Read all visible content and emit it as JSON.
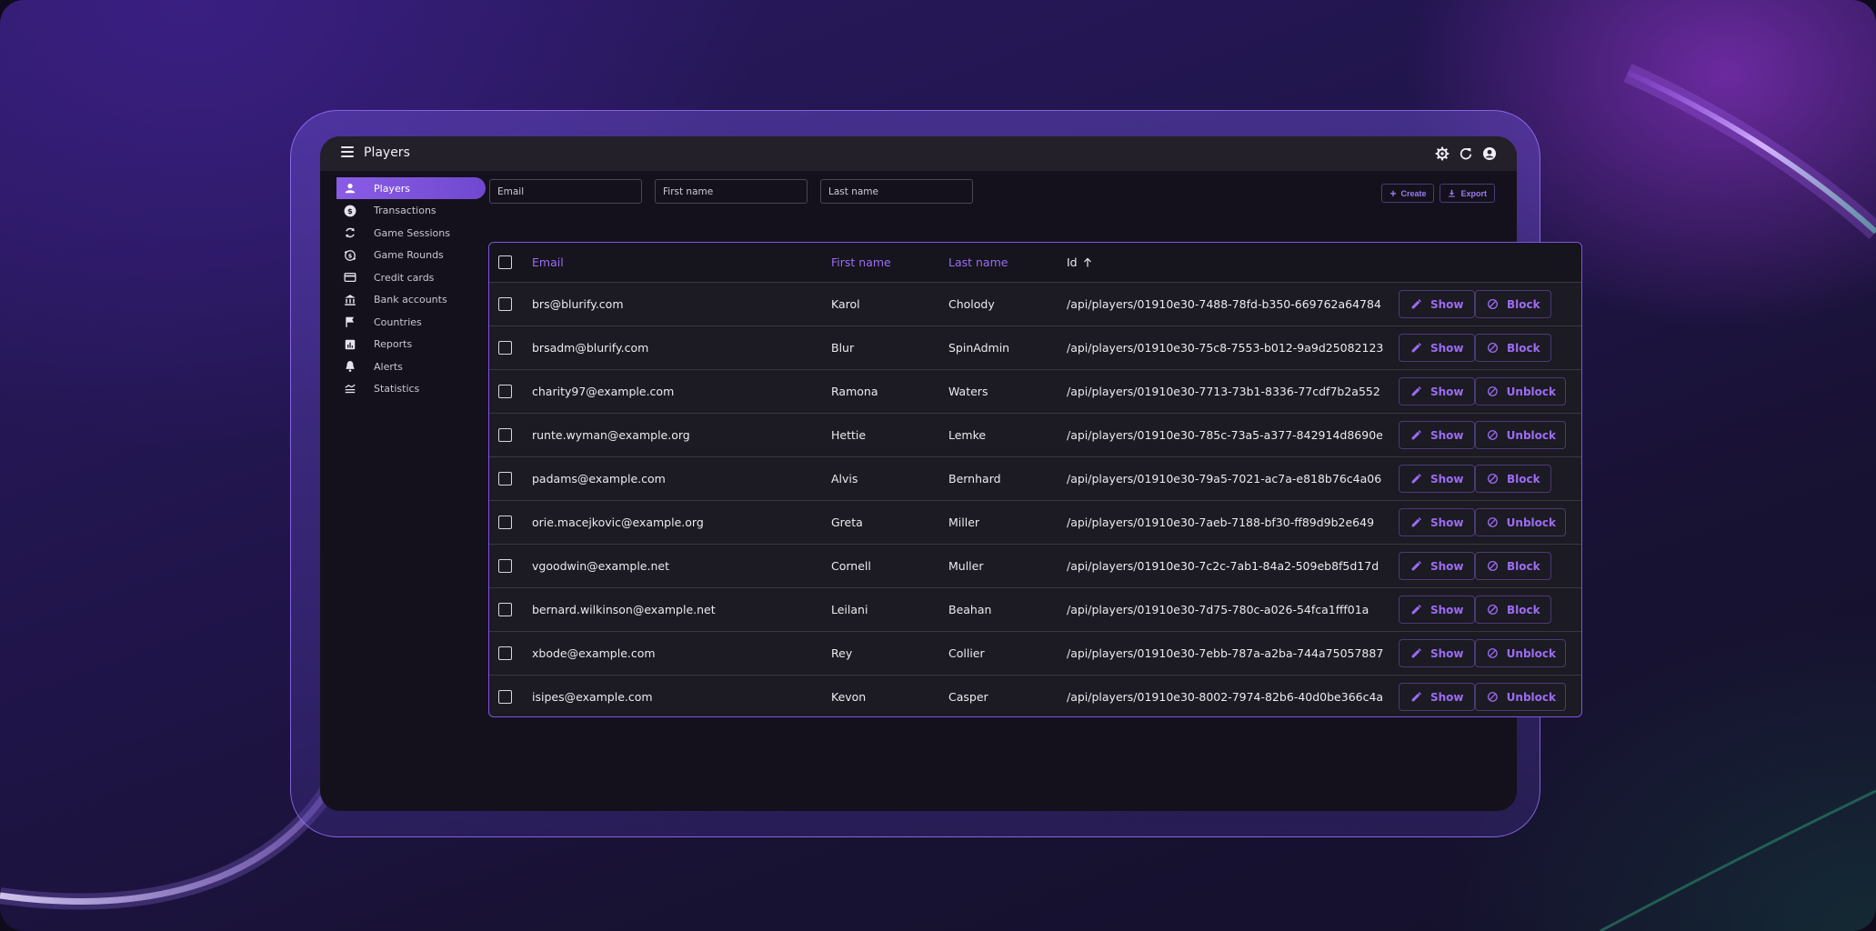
{
  "app": {
    "title": "Players"
  },
  "sidebar": {
    "items": [
      {
        "label": "Players",
        "icon": "person-icon",
        "active": true
      },
      {
        "label": "Transactions",
        "icon": "dollar-icon"
      },
      {
        "label": "Game Sessions",
        "icon": "sync-icon"
      },
      {
        "label": "Game Rounds",
        "icon": "currency-exchange-icon"
      },
      {
        "label": "Credit cards",
        "icon": "credit-card-icon"
      },
      {
        "label": "Bank accounts",
        "icon": "bank-icon"
      },
      {
        "label": "Countries",
        "icon": "flag-icon"
      },
      {
        "label": "Reports",
        "icon": "analytics-icon"
      },
      {
        "label": "Alerts",
        "icon": "bell-icon"
      },
      {
        "label": "Statistics",
        "icon": "stats-icon"
      }
    ]
  },
  "filters": {
    "email_placeholder": "Email",
    "first_name_placeholder": "First name",
    "last_name_placeholder": "Last name"
  },
  "toolbar": {
    "create_label": "Create",
    "export_label": "Export"
  },
  "table": {
    "columns": {
      "email": "Email",
      "first_name": "First name",
      "last_name": "Last name",
      "id": "Id"
    },
    "show_label": "Show",
    "rows": [
      {
        "email": "brs@blurify.com",
        "first_name": "Karol",
        "last_name": "Cholody",
        "id": "/api/players/01910e30-7488-78fd-b350-669762a64784",
        "action": "Block"
      },
      {
        "email": "brsadm@blurify.com",
        "first_name": "Blur",
        "last_name": "SpinAdmin",
        "id": "/api/players/01910e30-75c8-7553-b012-9a9d25082123",
        "action": "Block"
      },
      {
        "email": "charity97@example.com",
        "first_name": "Ramona",
        "last_name": "Waters",
        "id": "/api/players/01910e30-7713-73b1-8336-77cdf7b2a552",
        "action": "Unblock"
      },
      {
        "email": "runte.wyman@example.org",
        "first_name": "Hettie",
        "last_name": "Lemke",
        "id": "/api/players/01910e30-785c-73a5-a377-842914d8690e",
        "action": "Unblock"
      },
      {
        "email": "padams@example.com",
        "first_name": "Alvis",
        "last_name": "Bernhard",
        "id": "/api/players/01910e30-79a5-7021-ac7a-e818b76c4a06",
        "action": "Block"
      },
      {
        "email": "orie.macejkovic@example.org",
        "first_name": "Greta",
        "last_name": "Miller",
        "id": "/api/players/01910e30-7aeb-7188-bf30-ff89d9b2e649",
        "action": "Unblock"
      },
      {
        "email": "vgoodwin@example.net",
        "first_name": "Cornell",
        "last_name": "Muller",
        "id": "/api/players/01910e30-7c2c-7ab1-84a2-509eb8f5d17d",
        "action": "Block"
      },
      {
        "email": "bernard.wilkinson@example.net",
        "first_name": "Leilani",
        "last_name": "Beahan",
        "id": "/api/players/01910e30-7d75-780c-a026-54fca1fff01a",
        "action": "Block"
      },
      {
        "email": "xbode@example.com",
        "first_name": "Rey",
        "last_name": "Collier",
        "id": "/api/players/01910e30-7ebb-787a-a2ba-744a75057887",
        "action": "Unblock"
      },
      {
        "email": "isipes@example.com",
        "first_name": "Kevon",
        "last_name": "Casper",
        "id": "/api/players/01910e30-8002-7974-82b6-40d0be366c4a",
        "action": "Unblock"
      }
    ]
  },
  "colors": {
    "accent": "#9b6cf5",
    "active_nav": "#8a5ce6",
    "surface": "#1c1a22",
    "appbar": "#232029"
  }
}
